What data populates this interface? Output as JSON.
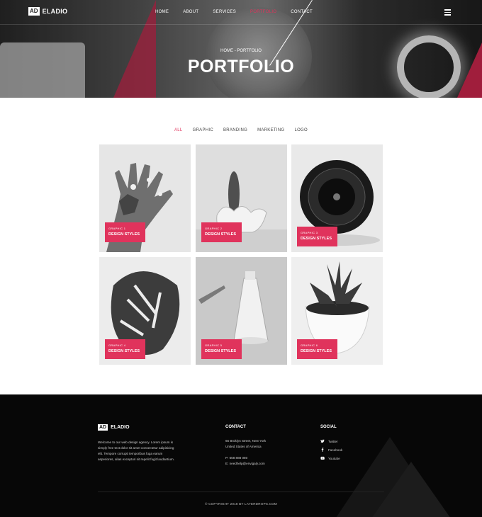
{
  "brand": {
    "logo_box": "AD",
    "name": "ELADIO"
  },
  "nav": {
    "items": [
      {
        "label": "HOME"
      },
      {
        "label": "ABOUT"
      },
      {
        "label": "SERVICES"
      },
      {
        "label": "PORTFOLIO"
      },
      {
        "label": "CONTACT"
      }
    ],
    "active_item": "PORTFOLIO"
  },
  "hero": {
    "breadcrumb": "HOME - PORTFOLIO",
    "title": "PORTFOLIO"
  },
  "filters": {
    "items": [
      "ALL",
      "GRAPHIC",
      "BRANDING",
      "MARKETING",
      "LOGO"
    ],
    "active": "ALL"
  },
  "portfolio": {
    "cards": [
      {
        "kicker": "GRAPHIC 1",
        "title": "DESIGN STYLES",
        "image": "painted-hand"
      },
      {
        "kicker": "GRAPHIC 2",
        "title": "DESIGN STYLES",
        "image": "cactus-banana"
      },
      {
        "kicker": "GRAPHIC 3",
        "title": "DESIGN STYLES",
        "image": "camera-lens"
      },
      {
        "kicker": "GRAPHIC 4",
        "title": "DESIGN STYLES",
        "image": "monstera-leaf"
      },
      {
        "kicker": "GRAPHIC 5",
        "title": "DESIGN STYLES",
        "image": "desk-lamp"
      },
      {
        "kicker": "GRAPHIC 6",
        "title": "DESIGN STYLES",
        "image": "succulent-pot"
      }
    ]
  },
  "footer": {
    "logo_box": "AD",
    "name": "ELADIO",
    "about": "Welcome to our web design agency. Lorem ipsum is simply free text dolor sit amet consectetur adipisicing elit. Tempore corrupti temporibus fuga earum asperiores, alias excepturi sit repelit fugit laudantium.",
    "contact_heading": "CONTACT",
    "address_1": "66 Broklyn Street, New York",
    "address_2": "United States of America",
    "phone": "P: 658 888 080",
    "email": "E: needhelp@envigaly.com",
    "social_heading": "SOCIAL",
    "social": [
      {
        "label": "Twitter",
        "icon": "twitter-icon"
      },
      {
        "label": "Facebook",
        "icon": "facebook-icon"
      },
      {
        "label": "Youtube",
        "icon": "youtube-icon"
      }
    ],
    "copyright": "© COPYRIGHT 2018 BY LAYERDROPS.COM"
  },
  "colors": {
    "accent": "#e0335c",
    "footer_bg": "#070707"
  }
}
